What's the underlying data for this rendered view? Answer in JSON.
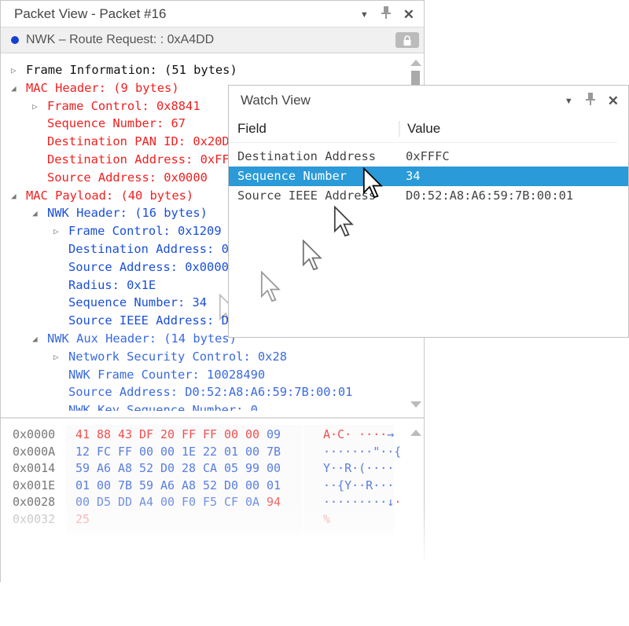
{
  "packet_view": {
    "title": "Packet View - Packet #16",
    "status": "NWK – Route Request: : 0xA4DD",
    "status_dot_color": "#1540d0",
    "tree": [
      {
        "level": 0,
        "expander": "collapsed",
        "color": "#111111",
        "text": "Frame Information: (51 bytes)"
      },
      {
        "level": 0,
        "expander": "expanded",
        "color": "#f02020",
        "text": "MAC Header: (9 bytes)"
      },
      {
        "level": 1,
        "expander": "collapsed",
        "color": "#f02020",
        "text": "Frame Control: 0x8841"
      },
      {
        "level": 1,
        "expander": "",
        "color": "#f02020",
        "text": "Sequence Number: 67"
      },
      {
        "level": 1,
        "expander": "",
        "color": "#f02020",
        "text": "Destination PAN ID: 0x20D"
      },
      {
        "level": 1,
        "expander": "",
        "color": "#f02020",
        "text": "Destination Address: 0xFF"
      },
      {
        "level": 1,
        "expander": "",
        "color": "#f02020",
        "text": "Source Address: 0x0000"
      },
      {
        "level": 0,
        "expander": "expanded",
        "color": "#f02020",
        "text": "MAC Payload: (40 bytes)"
      },
      {
        "level": 1,
        "expander": "expanded",
        "color": "#1a4fd8",
        "text": "NWK Header: (16 bytes)"
      },
      {
        "level": 2,
        "expander": "collapsed",
        "color": "#1a4fd8",
        "text": "Frame Control: 0x1209"
      },
      {
        "level": 2,
        "expander": "",
        "color": "#1a4fd8",
        "text": "Destination Address: 0"
      },
      {
        "level": 2,
        "expander": "",
        "color": "#1a4fd8",
        "text": "Source Address: 0x0000"
      },
      {
        "level": 2,
        "expander": "",
        "color": "#1a4fd8",
        "text": "Radius: 0x1E"
      },
      {
        "level": 2,
        "expander": "",
        "color": "#1a4fd8",
        "text": "Sequence Number: 34"
      },
      {
        "level": 2,
        "expander": "",
        "color": "#1a4fd8",
        "text": "Source IEEE Address: D"
      },
      {
        "level": 1,
        "expander": "expanded",
        "color": "#3a6ae0",
        "text": "NWK Aux Header: (14 bytes)"
      },
      {
        "level": 2,
        "expander": "collapsed",
        "color": "#3a6ae0",
        "text": "Network Security Control: 0x28"
      },
      {
        "level": 2,
        "expander": "",
        "color": "#3a6ae0",
        "text": "NWK Frame Counter: 10028490"
      },
      {
        "level": 2,
        "expander": "",
        "color": "#3a6ae0",
        "text": "Source Address: D0:52:A8:A6:59:7B:00:01"
      },
      {
        "level": 2,
        "expander": "",
        "color": "#3a6ae0",
        "text": "NWK Key Sequence Number: 0"
      }
    ],
    "hex": [
      {
        "offset": "0x0000",
        "bytes": [
          "41",
          "88",
          "43",
          "DF",
          "20",
          "FF",
          "FF",
          "00",
          "00",
          "09"
        ],
        "mac": [
          1,
          1,
          1,
          1,
          1,
          1,
          1,
          1,
          1,
          0
        ],
        "ascii": [
          {
            "t": "A·C· ····",
            "mac": 1
          },
          {
            "t": "→",
            "mac": 0
          }
        ]
      },
      {
        "offset": "0x000A",
        "bytes": [
          "12",
          "FC",
          "FF",
          "00",
          "00",
          "1E",
          "22",
          "01",
          "00",
          "7B"
        ],
        "mac": [
          0,
          0,
          0,
          0,
          0,
          0,
          0,
          0,
          0,
          0
        ],
        "ascii": [
          {
            "t": "·······\"··{",
            "mac": 0
          }
        ]
      },
      {
        "offset": "0x0014",
        "bytes": [
          "59",
          "A6",
          "A8",
          "52",
          "D0",
          "28",
          "CA",
          "05",
          "99",
          "00"
        ],
        "mac": [
          0,
          0,
          0,
          0,
          0,
          0,
          0,
          0,
          0,
          0
        ],
        "ascii": [
          {
            "t": "Y··R·(····",
            "mac": 0
          }
        ]
      },
      {
        "offset": "0x001E",
        "bytes": [
          "01",
          "00",
          "7B",
          "59",
          "A6",
          "A8",
          "52",
          "D0",
          "00",
          "01"
        ],
        "mac": [
          0,
          0,
          0,
          0,
          0,
          0,
          0,
          0,
          0,
          0
        ],
        "ascii": [
          {
            "t": "··{Y··R···",
            "mac": 0
          }
        ]
      },
      {
        "offset": "0x0028",
        "bytes": [
          "00",
          "D5",
          "DD",
          "A4",
          "00",
          "F0",
          "F5",
          "CF",
          "0A",
          "94"
        ],
        "mac": [
          0,
          0,
          0,
          0,
          0,
          0,
          0,
          0,
          0,
          1
        ],
        "ascii": [
          {
            "t": "·········↓",
            "mac": 0
          },
          {
            "t": "·",
            "mac": 1
          }
        ]
      },
      {
        "offset": "0x0032",
        "bytes": [
          "25"
        ],
        "mac": [
          1
        ],
        "ascii": [
          {
            "t": "%",
            "mac": 1
          }
        ]
      }
    ],
    "colors": {
      "mac": "#f05050",
      "nwk": "#5a7ee0",
      "offset": "#777777"
    }
  },
  "watch_view": {
    "title": "Watch View",
    "columns": [
      "Field",
      "Value"
    ],
    "rows": [
      {
        "field": "Destination Address",
        "value": "0xFFFC",
        "selected": false
      },
      {
        "field": "Sequence Number",
        "value": "34",
        "selected": true
      },
      {
        "field": "Source IEEE Address",
        "value": "D0:52:A8:A6:59:7B:00:01",
        "selected": false
      }
    ],
    "selection_color": "#2a9ad8"
  }
}
